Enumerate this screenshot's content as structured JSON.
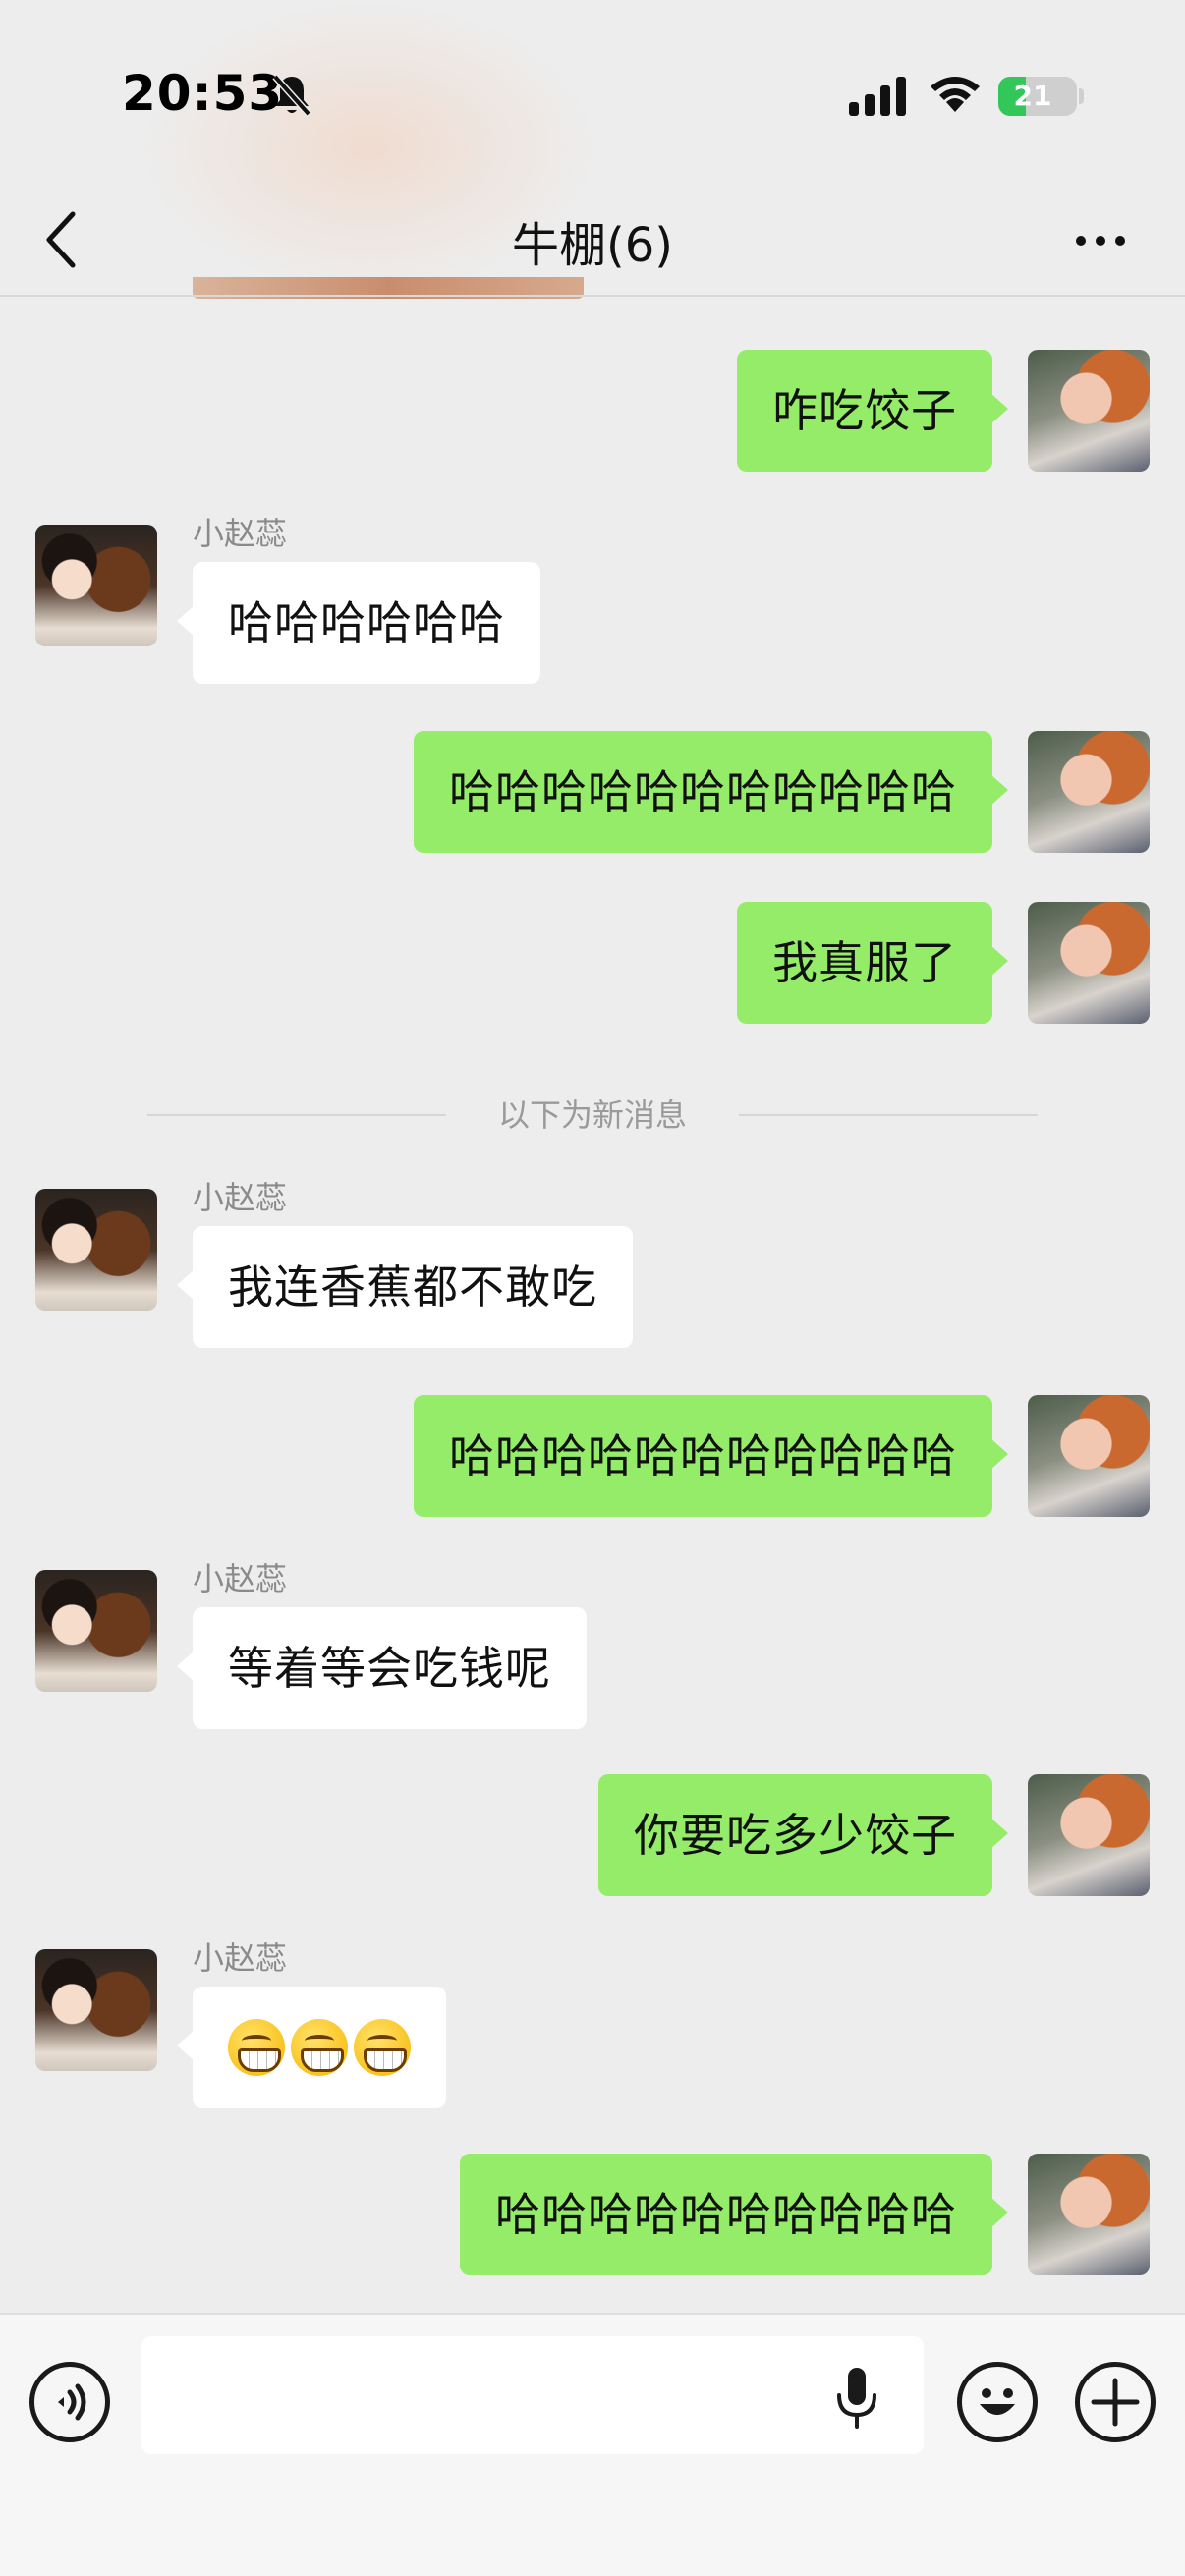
{
  "status_bar": {
    "time": "20:53",
    "battery_level": "21",
    "battery_charging": true,
    "icons": [
      "bell-off-icon",
      "signal-icon",
      "wifi-icon",
      "battery-icon"
    ]
  },
  "header": {
    "title": "牛棚(6)",
    "back_icon": "chevron-left-icon",
    "more_icon": "more-icon"
  },
  "divider_text": "以下为新消息",
  "messages": [
    {
      "from": "me",
      "text": "咋吃饺子"
    },
    {
      "from": "other",
      "sender": "小赵蕊",
      "text": "哈哈哈哈哈哈"
    },
    {
      "from": "me",
      "text": "哈哈哈哈哈哈哈哈哈哈哈"
    },
    {
      "from": "me",
      "text": "我真服了"
    },
    {
      "from": "other",
      "sender": "小赵蕊",
      "text": "我连香蕉都不敢吃"
    },
    {
      "from": "me",
      "text": "哈哈哈哈哈哈哈哈哈哈哈"
    },
    {
      "from": "other",
      "sender": "小赵蕊",
      "text": "等着等会吃钱呢"
    },
    {
      "from": "me",
      "text": "你要吃多少饺子"
    },
    {
      "from": "other",
      "sender": "小赵蕊",
      "emoji": [
        "grinning-face-icon",
        "grinning-face-icon",
        "grinning-face-icon"
      ]
    },
    {
      "from": "me",
      "text": "哈哈哈哈哈哈哈哈哈哈"
    }
  ],
  "input_bar": {
    "value": "",
    "icons": [
      "voice-icon",
      "microphone-icon",
      "emoji-icon",
      "plus-icon"
    ]
  },
  "colors": {
    "background": "#ededed",
    "my_bubble": "#95ec69",
    "their_bubble": "#ffffff",
    "battery_green": "#33c759"
  }
}
